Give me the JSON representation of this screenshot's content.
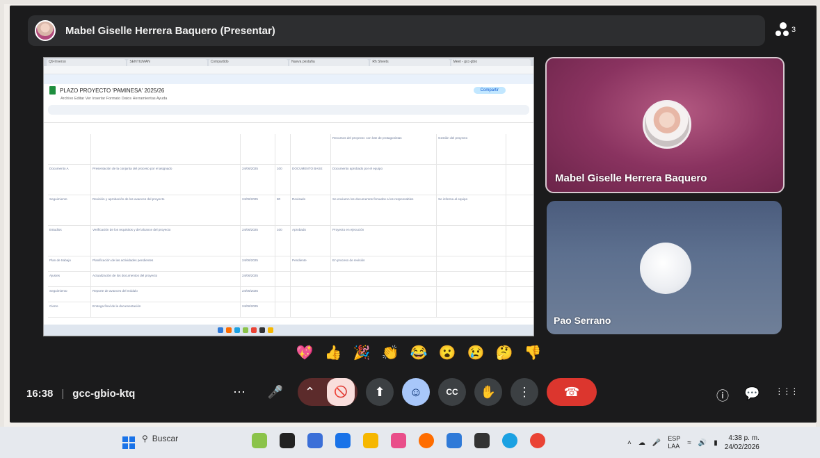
{
  "presenter": {
    "name": "Mabel Giselle Herrera Baquero (Presentar)"
  },
  "participants": {
    "count": "3"
  },
  "shared_screen": {
    "tabs": [
      "Q9-Inverso",
      "SENTIUMAN",
      "Compartido",
      "Nueva pestaña",
      "Rh Sheets",
      "Meet - gcc-gbio"
    ],
    "sheet_title": "PLAZO PROYECTO 'PAMINESA' 2025/26",
    "share_label": "Compartir",
    "menus": "Archivo  Editar  Ver  Insertar  Formato  Datos  Herramientas  Ayuda",
    "rows": [
      [
        "",
        "",
        "",
        "",
        "",
        "Recursos del proyecto: con lote de protagonistas",
        "Gestión del proyecto"
      ],
      [
        "Documento A",
        "Presentación de la conjunta del proceso por el asignado",
        "24/06/2025",
        "100",
        "DOCUMENTO BASE",
        "Documento aprobado por el equipo",
        ""
      ],
      [
        "Seguimiento",
        "Revisión y aprobación de los avances del proyecto",
        "24/06/2025",
        "80",
        "Revisado",
        "Se enviaron los documentos firmados a los responsables",
        "Se informa al equipo"
      ],
      [
        "Estudios",
        "Verificación de los requisitos y del alcance del proyecto",
        "24/06/2025",
        "100",
        "Aprobado",
        "Proyecto en ejecución",
        ""
      ],
      [
        "Plan de trabajo",
        "Planificación de las actividades pendientes",
        "24/06/2025",
        "",
        "Pendiente",
        "En proceso de revisión",
        ""
      ],
      [
        "Ajustes",
        "Actualización de los documentos del proyecto",
        "24/06/2025",
        "",
        "",
        "",
        ""
      ],
      [
        "Seguimiento",
        "Reporte de avances del módulo",
        "24/06/2025",
        "",
        "",
        "",
        ""
      ],
      [
        "Cierre",
        "Entrega final de la documentación",
        "24/06/2025",
        "",
        "",
        "",
        ""
      ]
    ]
  },
  "tiles": [
    {
      "name": "Mabel Giselle Herrera Baquero"
    },
    {
      "name": "Pao Serrano"
    }
  ],
  "reactions": [
    "💖",
    "👍",
    "🎉",
    "👏",
    "😂",
    "😮",
    "😢",
    "🤔",
    "👎"
  ],
  "meeting": {
    "time": "16:38",
    "code": "gcc-gbio-ktq"
  },
  "controls": {
    "more": "⋯",
    "mic": "🎤",
    "chevron": "⌃",
    "cam": "🚫",
    "present": "⬆",
    "emoji": "☺",
    "cc": "CC",
    "hand": "✋",
    "options": "⋮",
    "end": "☎"
  },
  "right_controls": {
    "info": "ⓘ",
    "chat": "💬",
    "activities": "⋮⋮⋮"
  },
  "windows": {
    "search": "Buscar",
    "lang1": "ESP",
    "lang2": "LAA",
    "time": "4:38 p. m.",
    "date": "24/02/2026",
    "icon_colors": [
      "#8bc34a",
      "#222222",
      "#3b6fd8",
      "#1a73e8",
      "#f6b700",
      "#e94e8a",
      "#ff6d00",
      "#2f7ad8",
      "#333333",
      "#1ba1e2",
      "#ea4335"
    ]
  },
  "colors": {
    "accent": "#a8c7fa",
    "end_call": "#dc362e",
    "cam_off": "#f9dedc"
  }
}
